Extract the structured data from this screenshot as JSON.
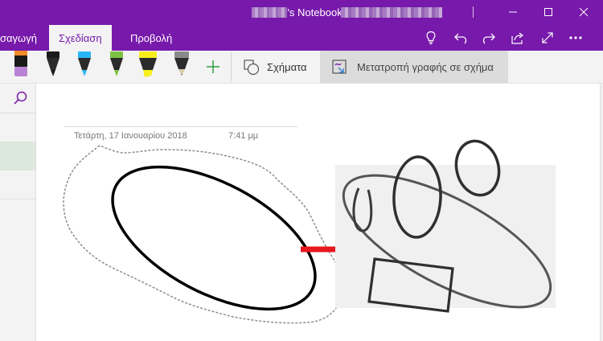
{
  "window": {
    "title_suffix": "'s Notebook –"
  },
  "ribbon": {
    "tabs": [
      {
        "label": "σαγωγή"
      },
      {
        "label": "Σχεδίαση"
      },
      {
        "label": "Προβολή"
      }
    ],
    "active_tab": "Σχεδίαση"
  },
  "toolbar": {
    "shapes_label": "Σχήματα",
    "convert_label": "Μετατροπή γραφής σε σχήμα",
    "pens": [
      {
        "name": "pen-black",
        "color": "#1a1a1a"
      },
      {
        "name": "pen-cyan",
        "color": "#29b6f6"
      },
      {
        "name": "pen-green",
        "color": "#7cc242"
      },
      {
        "name": "highlighter-yellow",
        "color": "#f7ee1c"
      },
      {
        "name": "pencil-gray",
        "color": "#8a8a8a"
      }
    ],
    "accent_color": "#7719aa"
  },
  "page": {
    "date": "Τετάρτη, 17 Ιανουαρίου 2018",
    "time": "7:41 μμ"
  }
}
